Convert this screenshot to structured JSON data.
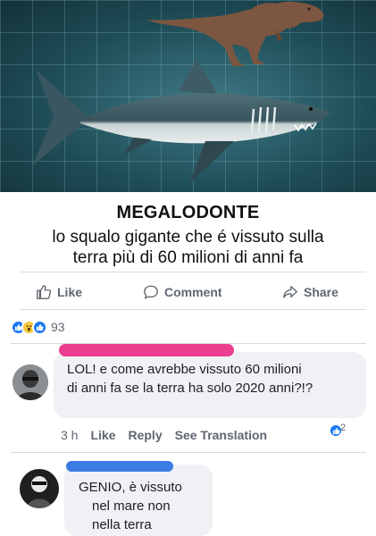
{
  "post": {
    "title": "MEGALODONTE",
    "line1": "lo squalo gigante che é vissuto sulla",
    "line2": "terra più di 60 milioni di anni fa"
  },
  "actions": {
    "like": "Like",
    "comment": "Comment",
    "share": "Share"
  },
  "reactions": {
    "count": "93",
    "icons": [
      "like-icon",
      "wow-icon",
      "like-icon"
    ]
  },
  "comments": [
    {
      "line1": "LOL! e come avrebbe vissuto 60 milioni",
      "line2": "di anni fa se la terra ha solo 2020 anni?!?",
      "time": "3 h",
      "like": "Like",
      "reply": "Reply",
      "translate": "See Translation",
      "reaction_count": "2",
      "censor_color": "#ec3e8f"
    },
    {
      "line1": "GENIO, è vissuto",
      "line2": "nel mare non",
      "line3": "nella terra",
      "censor_color": "#3b7be3"
    }
  ],
  "colors": {
    "accent": "#1877f2",
    "text_secondary": "#606770",
    "bubble": "#eff1f4"
  }
}
